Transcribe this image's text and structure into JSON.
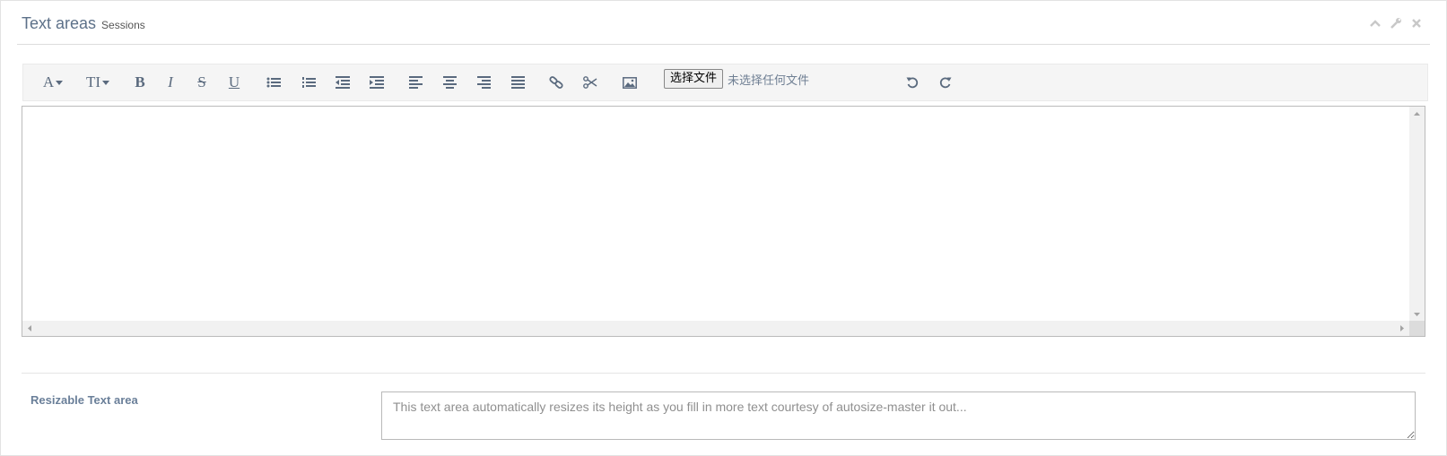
{
  "header": {
    "title": "Text areas",
    "subtitle": "Sessions",
    "tools": [
      "collapse-icon",
      "wrench-icon",
      "close-icon"
    ]
  },
  "toolbar": {
    "groups": [
      [
        "font-icon",
        "font-size-icon"
      ],
      [
        "bold-icon",
        "italic-icon",
        "strikethrough-icon",
        "underline-icon"
      ],
      [
        "bullet-list-icon",
        "numbered-list-icon",
        "outdent-icon",
        "indent-icon"
      ],
      [
        "align-left-icon",
        "align-center-icon",
        "align-right-icon",
        "justify-icon"
      ],
      [
        "link-icon",
        "unlink-icon"
      ],
      [
        "image-icon"
      ],
      [
        "undo-icon",
        "redo-icon"
      ]
    ],
    "font_label": "A",
    "font_size_label": "TI",
    "bold_label": "B",
    "italic_label": "I",
    "strike_label": "S",
    "underline_label": "U",
    "file_button_label": "选择文件",
    "file_status": "未选择任何文件"
  },
  "editor": {
    "content": ""
  },
  "resizable": {
    "label": "Resizable Text area",
    "placeholder": "This text area automatically resizes its height as you fill in more text courtesy of autosize-master it out..."
  },
  "colors": {
    "title": "#5d7189",
    "icon": "#5a6a7e",
    "label": "#6a7f99",
    "toolbar_bg": "#f5f5f5"
  }
}
